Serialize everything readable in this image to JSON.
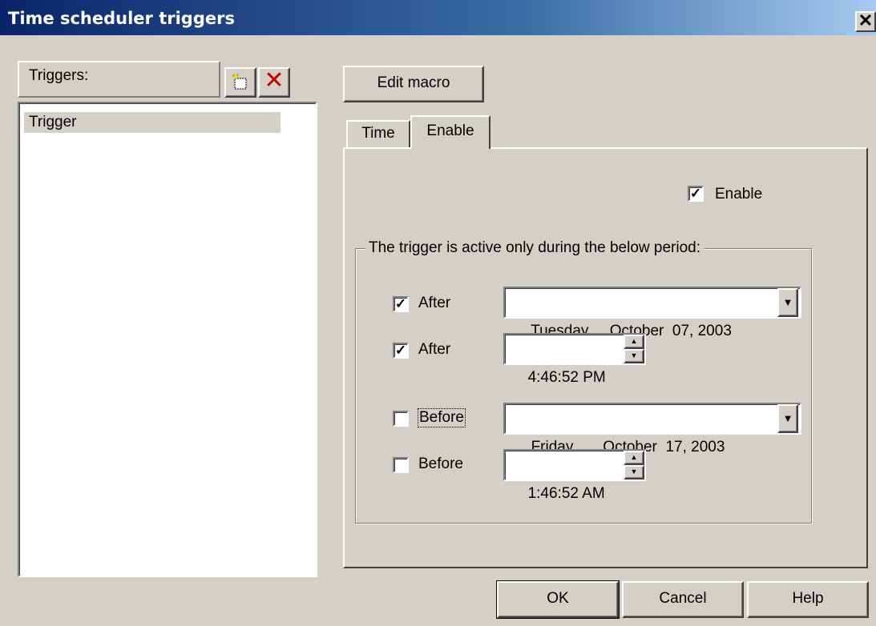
{
  "window": {
    "title": "Time scheduler triggers",
    "close_glyph": "✕"
  },
  "left_panel": {
    "label": "Triggers:",
    "add_icon": "new-trigger-icon",
    "delete_icon": "delete-trigger-icon",
    "delete_glyph": "✕",
    "delete_color": "#c00000",
    "items": [
      "Trigger"
    ]
  },
  "edit_macro_label": "Edit macro",
  "tabs": [
    {
      "label": "Time"
    },
    {
      "label": "Enable"
    }
  ],
  "active_tab": "Enable",
  "enable": {
    "label": "Enable",
    "checked": true,
    "check_glyph": "✓"
  },
  "period": {
    "caption": "The trigger is active only during the below period:",
    "rows": [
      {
        "label": "After",
        "checked": true,
        "value": "Tuesday  ,  October  07, 2003",
        "kind": "date"
      },
      {
        "label": "After",
        "checked": true,
        "value": "4:46:52 PM",
        "kind": "time"
      },
      {
        "label": "Before",
        "checked": false,
        "value": "Friday    ,  October  17, 2003",
        "kind": "date"
      },
      {
        "label": "Before",
        "checked": false,
        "value": "1:46:52 AM",
        "kind": "time"
      }
    ],
    "dropdown_glyph": "▼",
    "spin_up_glyph": "▲",
    "spin_down_glyph": "▼"
  },
  "footer": {
    "ok_label": "OK",
    "cancel_label": "Cancel",
    "help_label": "Help"
  }
}
